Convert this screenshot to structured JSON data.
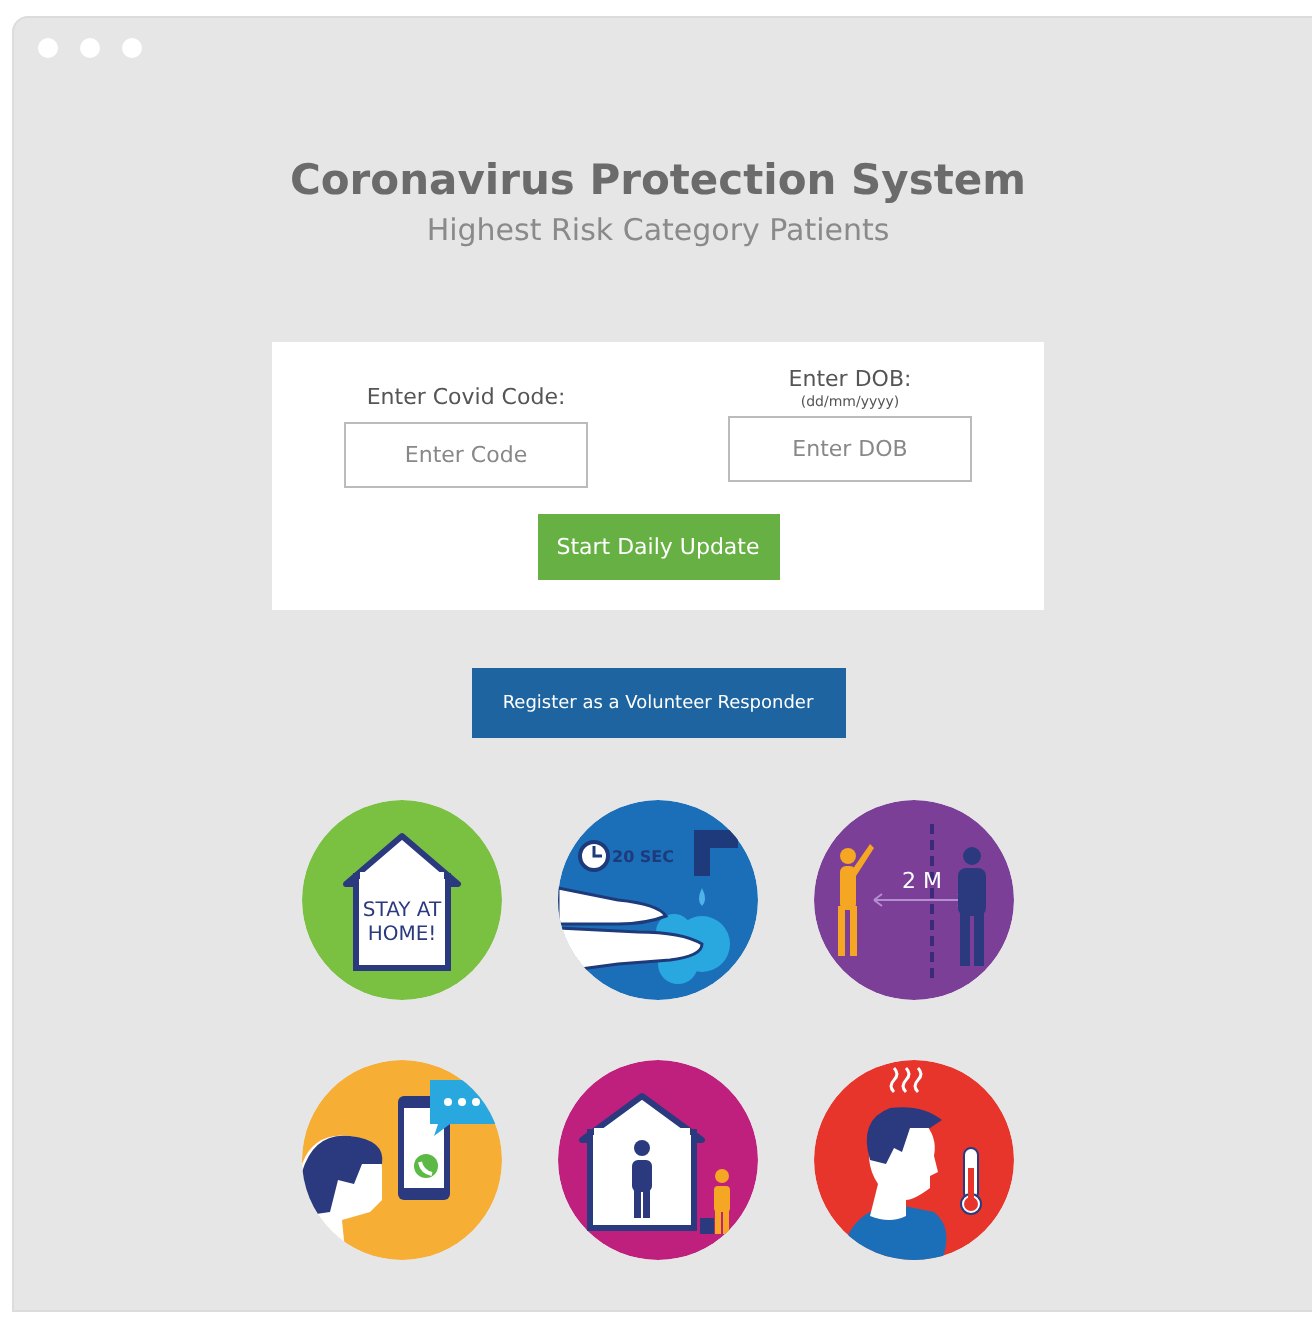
{
  "title": "Coronavirus Protection System",
  "subtitle": "Highest Risk Category Patients",
  "form": {
    "fields": [
      {
        "label": "Enter Covid Code:",
        "placeholder": "Enter Code"
      },
      {
        "label": "Enter DOB:",
        "hint": "(dd/mm/yyyy)",
        "placeholder": "Enter DOB"
      }
    ],
    "submit": "Start Daily Update"
  },
  "volunteer_button": "Register as a Volunteer Responder",
  "advice_icons": [
    {
      "kind": "stay-home",
      "lines": [
        "STAY AT",
        "HOME!"
      ]
    },
    {
      "kind": "hand-washing",
      "lines": [
        "20 SEC"
      ]
    },
    {
      "kind": "distancing",
      "lines": [
        "2 M"
      ]
    },
    {
      "kind": "phone-call"
    },
    {
      "kind": "home-isolation"
    },
    {
      "kind": "fever"
    }
  ]
}
